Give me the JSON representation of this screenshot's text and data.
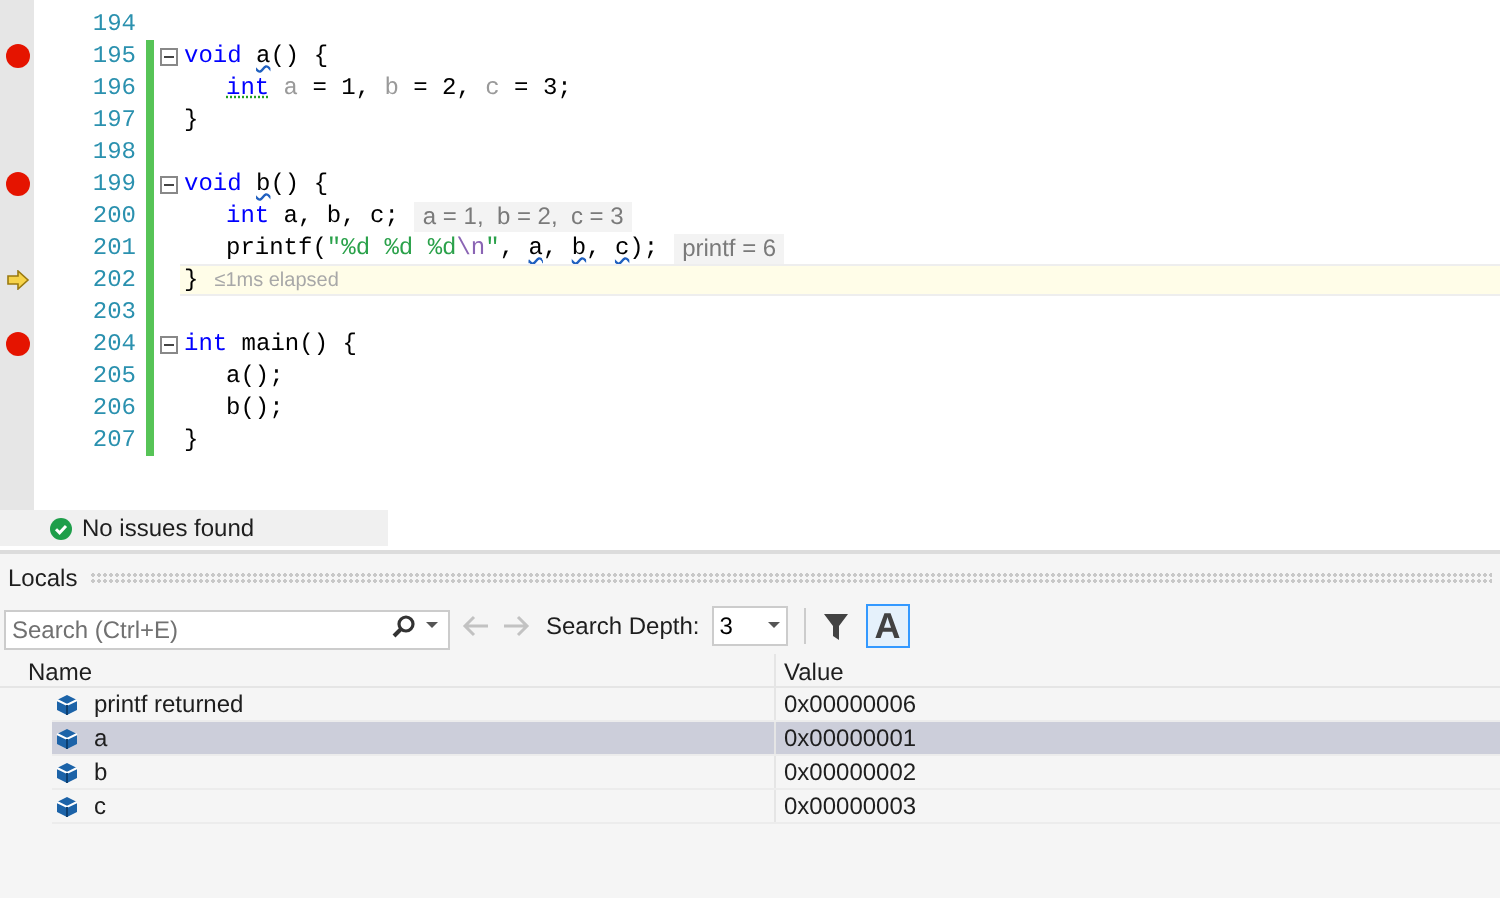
{
  "editor": {
    "lines": [
      {
        "number": "194",
        "breakpoint": false,
        "current": false,
        "fold": false,
        "changed": false,
        "indented": false
      },
      {
        "number": "195",
        "breakpoint": true,
        "current": false,
        "fold": true,
        "changed": true,
        "indented": false,
        "tokens": [
          {
            "kind": "kw",
            "text": "void "
          },
          {
            "kind": "warn",
            "text": "a"
          },
          {
            "kind": "text",
            "text": "() {"
          }
        ]
      },
      {
        "number": "196",
        "breakpoint": false,
        "current": false,
        "fold": false,
        "changed": true,
        "indented": true,
        "tokens": [
          {
            "kind": "kwnote",
            "text": "int"
          },
          {
            "kind": "unused",
            "text": " a"
          },
          {
            "kind": "text",
            "text": " = 1, "
          },
          {
            "kind": "unused",
            "text": "b"
          },
          {
            "kind": "text",
            "text": " = 2, "
          },
          {
            "kind": "unused",
            "text": "c"
          },
          {
            "kind": "text",
            "text": " = 3;"
          }
        ]
      },
      {
        "number": "197",
        "breakpoint": false,
        "current": false,
        "fold": false,
        "changed": true,
        "indented": false,
        "tokens": [
          {
            "kind": "text",
            "text": "}"
          }
        ]
      },
      {
        "number": "198",
        "breakpoint": false,
        "current": false,
        "fold": false,
        "changed": true,
        "indented": false
      },
      {
        "number": "199",
        "breakpoint": true,
        "current": false,
        "fold": true,
        "changed": true,
        "indented": false,
        "tokens": [
          {
            "kind": "kw",
            "text": "void "
          },
          {
            "kind": "warn",
            "text": "b"
          },
          {
            "kind": "text",
            "text": "() {"
          }
        ]
      },
      {
        "number": "200",
        "breakpoint": false,
        "current": false,
        "fold": false,
        "changed": true,
        "indented": true,
        "tokens": [
          {
            "kind": "kw",
            "text": "int"
          },
          {
            "kind": "text",
            "text": " a, b, c;"
          }
        ],
        "hint": "a = 1,  b = 2,  c = 3"
      },
      {
        "number": "201",
        "breakpoint": false,
        "current": false,
        "fold": false,
        "changed": true,
        "indented": true,
        "tokens": [
          {
            "kind": "text",
            "text": "printf("
          },
          {
            "kind": "str",
            "text": "\"%d %d %d"
          },
          {
            "kind": "esc",
            "text": "\\n"
          },
          {
            "kind": "str",
            "text": "\""
          },
          {
            "kind": "text",
            "text": ", "
          },
          {
            "kind": "warn",
            "text": "a"
          },
          {
            "kind": "text",
            "text": ", "
          },
          {
            "kind": "warn",
            "text": "b"
          },
          {
            "kind": "text",
            "text": ", "
          },
          {
            "kind": "warn",
            "text": "c"
          },
          {
            "kind": "text",
            "text": ");"
          }
        ],
        "hint": "printf = 6"
      },
      {
        "number": "202",
        "breakpoint": false,
        "current": true,
        "fold": false,
        "changed": true,
        "indented": false,
        "tokens": [
          {
            "kind": "text",
            "text": "}"
          }
        ],
        "elapsed": "≤1ms elapsed"
      },
      {
        "number": "203",
        "breakpoint": false,
        "current": false,
        "fold": false,
        "changed": true,
        "indented": false
      },
      {
        "number": "204",
        "breakpoint": true,
        "current": false,
        "fold": true,
        "changed": true,
        "indented": false,
        "tokens": [
          {
            "kind": "kw",
            "text": "int"
          },
          {
            "kind": "text",
            "text": " main() {"
          }
        ]
      },
      {
        "number": "205",
        "breakpoint": false,
        "current": false,
        "fold": false,
        "changed": true,
        "indented": true,
        "tokens": [
          {
            "kind": "text",
            "text": "a();"
          }
        ]
      },
      {
        "number": "206",
        "breakpoint": false,
        "current": false,
        "fold": false,
        "changed": true,
        "indented": true,
        "tokens": [
          {
            "kind": "text",
            "text": "b();"
          }
        ]
      },
      {
        "number": "207",
        "breakpoint": false,
        "current": false,
        "fold": false,
        "changed": true,
        "indented": false,
        "tokens": [
          {
            "kind": "text",
            "text": "}"
          }
        ]
      }
    ]
  },
  "status": {
    "text": "No issues found"
  },
  "locals": {
    "title": "Locals",
    "search": {
      "placeholder": "Search (Ctrl+E)"
    },
    "depth_label": "Search Depth:",
    "depth": "3",
    "filter_on": false,
    "aa_button": {
      "text": "A",
      "selected": true
    },
    "columns": [
      "Name",
      "Value"
    ],
    "rows": [
      {
        "name": "printf returned",
        "value": "0x00000006",
        "selected": false
      },
      {
        "name": "a",
        "value": "0x00000001",
        "selected": true
      },
      {
        "name": "b",
        "value": "0x00000002",
        "selected": false
      },
      {
        "name": "c",
        "value": "0x00000003",
        "selected": false
      }
    ]
  }
}
